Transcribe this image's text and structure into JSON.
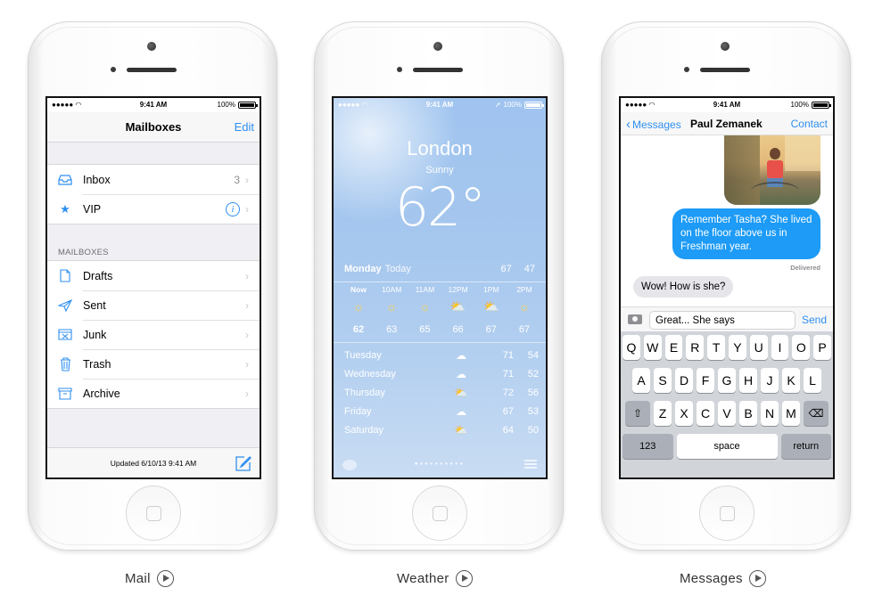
{
  "status_bar": {
    "time": "9:41 AM",
    "battery": "100%"
  },
  "mail": {
    "nav_title": "Mailboxes",
    "edit_label": "Edit",
    "top_items": [
      {
        "icon": "inbox-icon",
        "label": "Inbox",
        "count": "3"
      },
      {
        "icon": "star-icon",
        "label": "VIP"
      }
    ],
    "section_header": "MAILBOXES",
    "mailboxes": [
      {
        "icon": "draft-icon",
        "label": "Drafts"
      },
      {
        "icon": "paper-plane-icon",
        "label": "Sent"
      },
      {
        "icon": "junk-icon",
        "label": "Junk"
      },
      {
        "icon": "trash-icon",
        "label": "Trash"
      },
      {
        "icon": "archive-icon",
        "label": "Archive"
      }
    ],
    "updated": "Updated 6/10/13 9:41 AM"
  },
  "weather": {
    "city": "London",
    "condition": "Sunny",
    "temperature": "62°",
    "day": "Monday",
    "day_sub": "Today",
    "high": "67",
    "low": "47",
    "hourly": [
      {
        "hour": "Now",
        "icon": "sun-icon",
        "temp": "62"
      },
      {
        "hour": "10AM",
        "icon": "sun-icon",
        "temp": "63"
      },
      {
        "hour": "11AM",
        "icon": "sun-icon",
        "temp": "65"
      },
      {
        "hour": "12PM",
        "icon": "partly-cloudy-icon",
        "temp": "66"
      },
      {
        "hour": "1PM",
        "icon": "partly-cloudy-icon",
        "temp": "67"
      },
      {
        "hour": "2PM",
        "icon": "sun-icon",
        "temp": "67"
      }
    ],
    "forecast": [
      {
        "day": "Tuesday",
        "icon": "cloud-icon",
        "high": "71",
        "low": "54"
      },
      {
        "day": "Wednesday",
        "icon": "cloud-icon",
        "high": "71",
        "low": "52"
      },
      {
        "day": "Thursday",
        "icon": "partly-cloudy-icon",
        "high": "72",
        "low": "56"
      },
      {
        "day": "Friday",
        "icon": "cloud-icon",
        "high": "67",
        "low": "53"
      },
      {
        "day": "Saturday",
        "icon": "partly-cloudy-icon",
        "high": "64",
        "low": "50"
      }
    ]
  },
  "messages": {
    "back_label": "Messages",
    "contact_name": "Paul Zemanek",
    "contact_button": "Contact",
    "outgoing_text": "Remember Tasha? She lived on the floor above us in Freshman year.",
    "delivered": "Delivered",
    "incoming_text": "Wow! How is she?",
    "input_value": "Great... She says",
    "send_label": "Send",
    "keyboard": {
      "row1": [
        "Q",
        "W",
        "E",
        "R",
        "T",
        "Y",
        "U",
        "I",
        "O",
        "P"
      ],
      "row2": [
        "A",
        "S",
        "D",
        "F",
        "G",
        "H",
        "J",
        "K",
        "L"
      ],
      "row3": [
        "Z",
        "X",
        "C",
        "V",
        "B",
        "N",
        "M"
      ],
      "numbers_key": "123",
      "space_key": "space",
      "return_key": "return"
    }
  },
  "captions": {
    "mail": "Mail",
    "weather": "Weather",
    "messages": "Messages"
  },
  "colors": {
    "accent": "#2f8ff0",
    "bubble_out": "#1d9bf6",
    "bubble_in": "#e5e5ea",
    "weather_sky": "#a6c7ee",
    "sun": "#ffd54a"
  }
}
